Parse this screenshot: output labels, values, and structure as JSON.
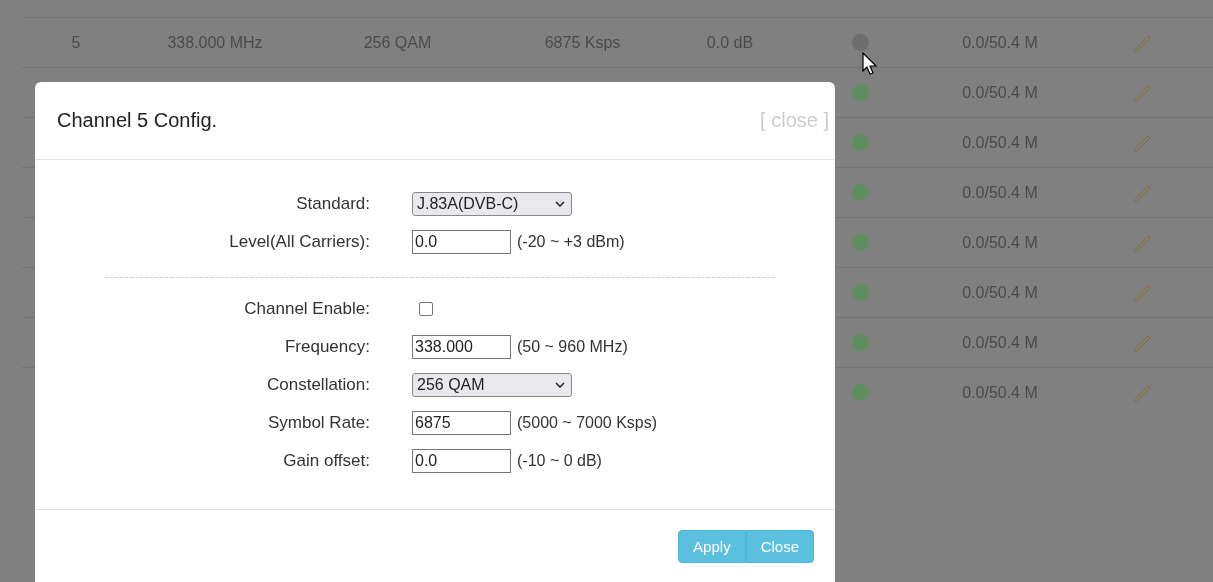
{
  "table": {
    "rows": [
      {
        "cells": [
          "5",
          "338.000 MHz",
          "256 QAM",
          "6875 Ksps",
          "0.0 dB"
        ],
        "color": "#6e6e6e",
        "bitrate": "0.0/50.4 M"
      },
      {
        "color": "#5f8f5f",
        "bitrate": "0.0/50.4 M"
      },
      {
        "color": "#5f8f5f",
        "bitrate": "0.0/50.4 M"
      },
      {
        "color": "#5f8f5f",
        "bitrate": "0.0/50.4 M"
      },
      {
        "color": "#5f8f5f",
        "bitrate": "0.0/50.4 M"
      },
      {
        "color": "#5f8f5f",
        "bitrate": "0.0/50.4 M"
      },
      {
        "color": "#5f8f5f",
        "bitrate": "0.0/50.4 M"
      },
      {
        "color": "#5f8f5f",
        "bitrate": "0.0/50.4 M"
      }
    ]
  },
  "dialog": {
    "title": "Channel 5 Config.",
    "close_link": "[ close ]",
    "sections": [
      [
        {
          "kind": "select",
          "label": "Standard:",
          "value": "J.83A(DVB-C)"
        },
        {
          "kind": "input",
          "label": "Level(All Carriers):",
          "value": "0.0",
          "hint": "(-20 ~ +3 dBm)"
        }
      ],
      [
        {
          "kind": "checkbox",
          "label": "Channel Enable:",
          "checked": false
        },
        {
          "kind": "input",
          "label": "Frequency:",
          "value": "338.000",
          "hint": "(50 ~ 960 MHz)"
        },
        {
          "kind": "select",
          "label": "Constellation:",
          "value": "256 QAM"
        },
        {
          "kind": "input",
          "label": "Symbol Rate:",
          "value": "6875",
          "hint": "(5000 ~ 7000 Ksps)"
        },
        {
          "kind": "input",
          "label": "Gain offset:",
          "value": "0.0",
          "hint": "(-10 ~ 0 dB)"
        }
      ]
    ],
    "buttons": [
      "Apply",
      "Close"
    ]
  }
}
